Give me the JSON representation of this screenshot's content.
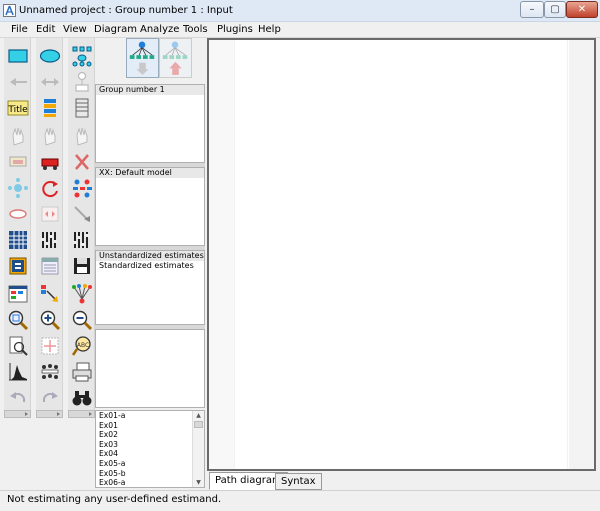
{
  "window": {
    "title": "Unnamed project : Group number 1 : Input",
    "min_icon": "minimize-icon",
    "max_icon": "maximize-icon",
    "close_icon": "close-icon",
    "min_glyph": "–",
    "max_glyph": "▢",
    "close_glyph": "✕"
  },
  "menu": {
    "items": [
      "File",
      "Edit",
      "View",
      "Diagram",
      "Analyze",
      "Tools",
      "Plugins",
      "Help"
    ]
  },
  "toolbox": {
    "icons": [
      "rectangle-icon",
      "ellipse-icon",
      "indicator-icon",
      "single-arrow-icon",
      "double-arrow-icon",
      "unique-variable-icon",
      "title-icon",
      "list-variables-icon",
      "list-data-icon",
      "select-one-icon",
      "select-all-icon",
      "deselect-icon",
      "duplicate-icon",
      "move-icon",
      "erase-icon",
      "shape-change-icon",
      "rotate-icon",
      "reflect-icon",
      "move-parameter-icon",
      "scroll-icon",
      "touch-up-icon",
      "data-files-icon",
      "analysis-properties-icon",
      "calculate-icon",
      "view-text-icon",
      "object-properties-icon",
      "save-icon",
      "drag-properties-icon",
      "preserve-symmetries-icon",
      "multiple-groups-icon",
      "zoom-select-icon",
      "zoom-in-icon",
      "zoom-out-icon",
      "zoom-page-icon",
      "fit-page-icon",
      "loupe-icon",
      "bayesian-icon",
      "multiple-group-analysis-icon",
      "print-icon",
      "undo-icon",
      "redo-icon",
      "specification-search-icon"
    ],
    "title_label": "Title"
  },
  "view_buttons": {
    "input_icon": "view-input-diagram-icon",
    "output_icon": "view-output-diagram-icon"
  },
  "groups_panel": {
    "items": [
      "Group number 1"
    ]
  },
  "models_panel": {
    "items": [
      "XX: Default model"
    ]
  },
  "estimates_panel": {
    "items": [
      "Unstandardized estimates",
      "Standardized estimates"
    ]
  },
  "files_panel": {
    "items": [
      "Ex01-a",
      "Ex01",
      "Ex02",
      "Ex03",
      "Ex04",
      "Ex05-a",
      "Ex05-b",
      "Ex06-a"
    ]
  },
  "tabs": [
    {
      "label": "Path diagram",
      "active": true
    },
    {
      "label": "Syntax",
      "active": false
    }
  ],
  "status": {
    "text": "Not estimating any user-defined estimand."
  },
  "colors": {
    "titlebar": "#dfe9f5",
    "accent_blue": "#1f7fd8",
    "canvas_border": "#6a6a6a"
  }
}
